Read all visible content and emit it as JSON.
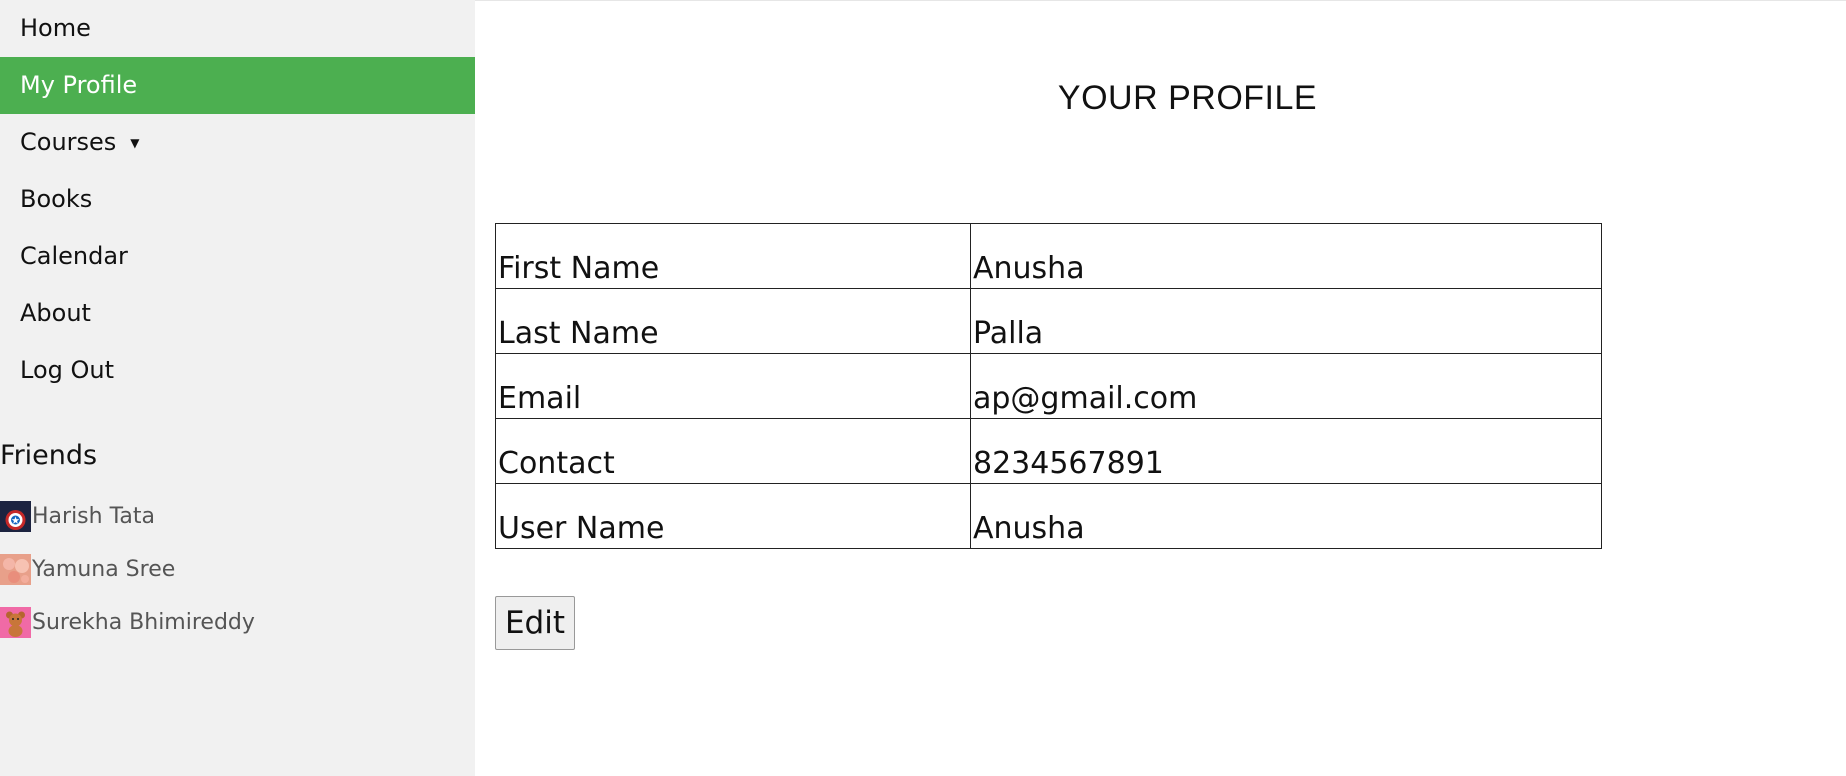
{
  "sidebar": {
    "nav": [
      {
        "label": "Home",
        "active": false
      },
      {
        "label": "My Profile",
        "active": true
      },
      {
        "label": "Courses",
        "active": false,
        "has_dropdown": true,
        "caret": "▼"
      },
      {
        "label": "Books",
        "active": false
      },
      {
        "label": "Calendar",
        "active": false
      },
      {
        "label": "About",
        "active": false
      },
      {
        "label": "Log Out",
        "active": false
      }
    ],
    "friends_heading": "Friends",
    "friends": [
      {
        "name": "Harish Tata",
        "avatar": "shield-avatar"
      },
      {
        "name": "Yamuna Sree",
        "avatar": "flowers-avatar"
      },
      {
        "name": "Surekha Bhimireddy",
        "avatar": "teddy-bear-avatar"
      }
    ]
  },
  "main": {
    "title": "YOUR PROFILE",
    "profile_rows": [
      {
        "label": "First Name",
        "value": "Anusha"
      },
      {
        "label": "Last Name",
        "value": "Palla"
      },
      {
        "label": "Email",
        "value": "ap@gmail.com"
      },
      {
        "label": "Contact",
        "value": "8234567891"
      },
      {
        "label": "User Name",
        "value": "Anusha"
      }
    ],
    "edit_label": "Edit"
  },
  "colors": {
    "sidebar_bg": "#f1f1f1",
    "active_nav_bg": "#4caf50",
    "active_nav_text": "#ffffff"
  }
}
